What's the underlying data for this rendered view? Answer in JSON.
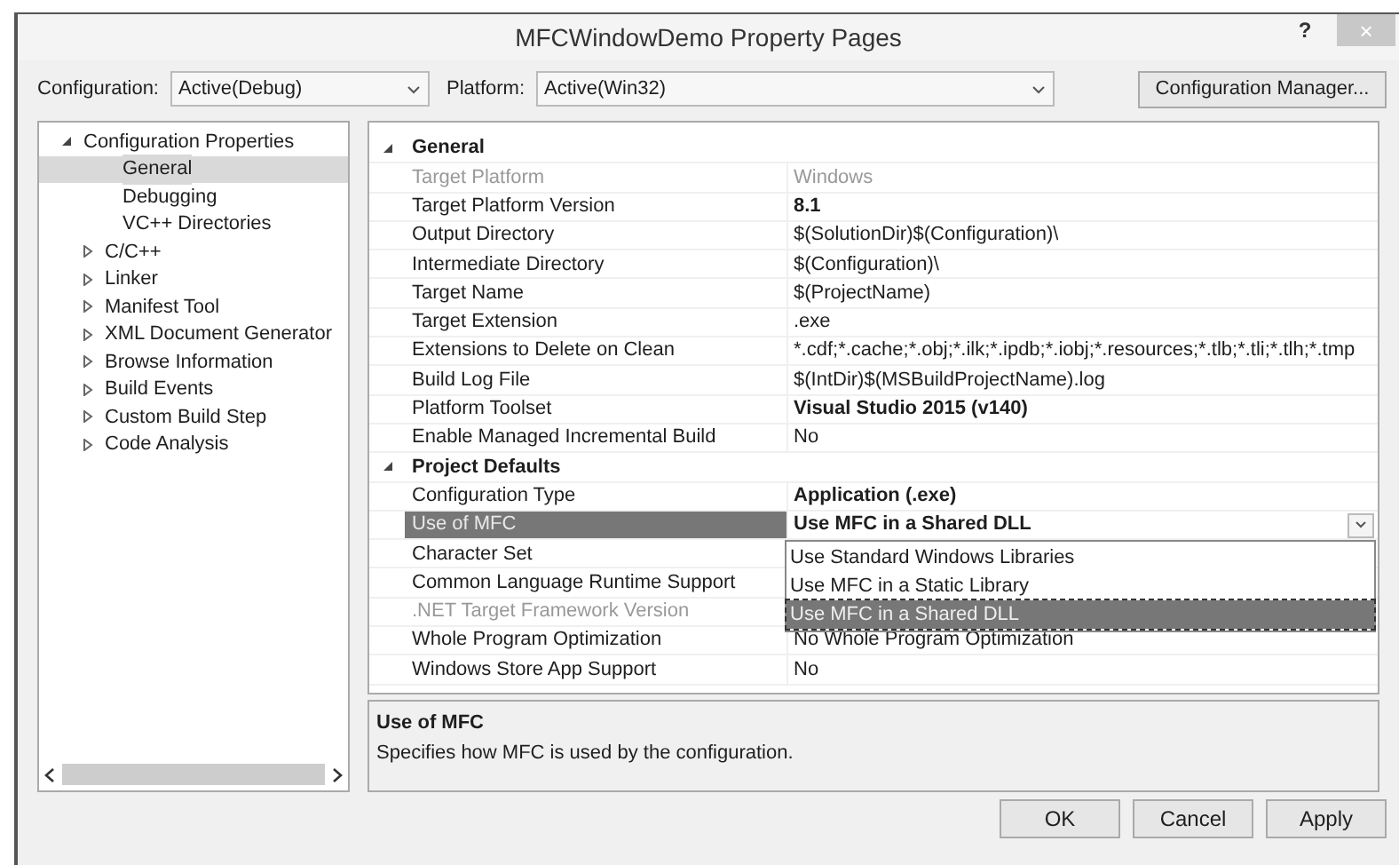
{
  "window": {
    "title": "MFCWindowDemo Property Pages",
    "help": "?",
    "close": "×"
  },
  "toolbar": {
    "configuration_label": "Configuration:",
    "configuration": "Active(Debug)",
    "platform_label": "Platform:",
    "platform": "Active(Win32)",
    "manager_button": "Configuration Manager..."
  },
  "tree": [
    {
      "label": "Configuration Properties",
      "expanded": true,
      "selected": false,
      "children": [
        {
          "label": "General",
          "selected": true
        },
        {
          "label": "Debugging",
          "selected": false
        },
        {
          "label": "VC++ Directories",
          "selected": false
        },
        {
          "label": "C/C++",
          "expanded": false,
          "selected": false
        },
        {
          "label": "Linker",
          "expanded": false,
          "selected": false
        },
        {
          "label": "Manifest Tool",
          "expanded": false,
          "selected": false
        },
        {
          "label": "XML Document Generator",
          "expanded": false,
          "selected": false
        },
        {
          "label": "Browse Information",
          "expanded": false,
          "selected": false
        },
        {
          "label": "Build Events",
          "expanded": false,
          "selected": false
        },
        {
          "label": "Custom Build Step",
          "expanded": false,
          "selected": false
        },
        {
          "label": "Code Analysis",
          "expanded": false,
          "selected": false
        }
      ]
    }
  ],
  "grid": [
    {
      "kind": "category",
      "label": "General",
      "expanded": true
    },
    {
      "kind": "property",
      "label": "Target Platform",
      "value": "Windows",
      "modified": false,
      "disabled": true,
      "selected": false
    },
    {
      "kind": "property",
      "label": "Target Platform Version",
      "value": "8.1",
      "modified": true,
      "disabled": false,
      "selected": false
    },
    {
      "kind": "property",
      "label": "Output Directory",
      "value": "$(SolutionDir)$(Configuration)\\",
      "modified": false,
      "disabled": false,
      "selected": false
    },
    {
      "kind": "property",
      "label": "Intermediate Directory",
      "value": "$(Configuration)\\",
      "modified": false,
      "disabled": false,
      "selected": false
    },
    {
      "kind": "property",
      "label": "Target Name",
      "value": "$(ProjectName)",
      "modified": false,
      "disabled": false,
      "selected": false
    },
    {
      "kind": "property",
      "label": "Target Extension",
      "value": ".exe",
      "modified": false,
      "disabled": false,
      "selected": false
    },
    {
      "kind": "property",
      "label": "Extensions to Delete on Clean",
      "value": "*.cdf;*.cache;*.obj;*.ilk;*.ipdb;*.iobj;*.resources;*.tlb;*.tli;*.tlh;*.tmp",
      "modified": false,
      "disabled": false,
      "selected": false
    },
    {
      "kind": "property",
      "label": "Build Log File",
      "value": "$(IntDir)$(MSBuildProjectName).log",
      "modified": false,
      "disabled": false,
      "selected": false
    },
    {
      "kind": "property",
      "label": "Platform Toolset",
      "value": "Visual Studio 2015 (v140)",
      "modified": true,
      "disabled": false,
      "selected": false
    },
    {
      "kind": "property",
      "label": "Enable Managed Incremental Build",
      "value": "No",
      "modified": false,
      "disabled": false,
      "selected": false
    },
    {
      "kind": "category",
      "label": "Project Defaults",
      "expanded": true
    },
    {
      "kind": "property",
      "label": "Configuration Type",
      "value": "Application (.exe)",
      "modified": true,
      "disabled": false,
      "selected": false
    },
    {
      "kind": "property",
      "label": "Use of MFC",
      "value": "Use MFC in a Shared DLL",
      "modified": true,
      "disabled": false,
      "selected": true,
      "dropdown": {
        "open": true,
        "options": [
          {
            "label": "Use Standard Windows Libraries",
            "selected": false
          },
          {
            "label": "Use MFC in a Static Library",
            "selected": false
          },
          {
            "label": "Use MFC in a Shared DLL",
            "selected": true
          }
        ]
      }
    },
    {
      "kind": "property",
      "label": "Character Set",
      "disabled": false,
      "selected": false
    },
    {
      "kind": "property",
      "label": "Common Language Runtime Support",
      "disabled": false,
      "selected": false
    },
    {
      "kind": "property",
      "label": ".NET Target Framework Version",
      "disabled": true,
      "selected": false
    },
    {
      "kind": "property",
      "label": "Whole Program Optimization",
      "value": "No Whole Program Optimization",
      "modified": false,
      "disabled": false,
      "selected": false
    },
    {
      "kind": "property",
      "label": "Windows Store App Support",
      "value": "No",
      "modified": false,
      "disabled": false,
      "selected": false
    }
  ],
  "description": {
    "title": "Use of MFC",
    "text": "Specifies how MFC is used by the configuration."
  },
  "buttons": [
    "OK",
    "Cancel",
    "Apply"
  ]
}
